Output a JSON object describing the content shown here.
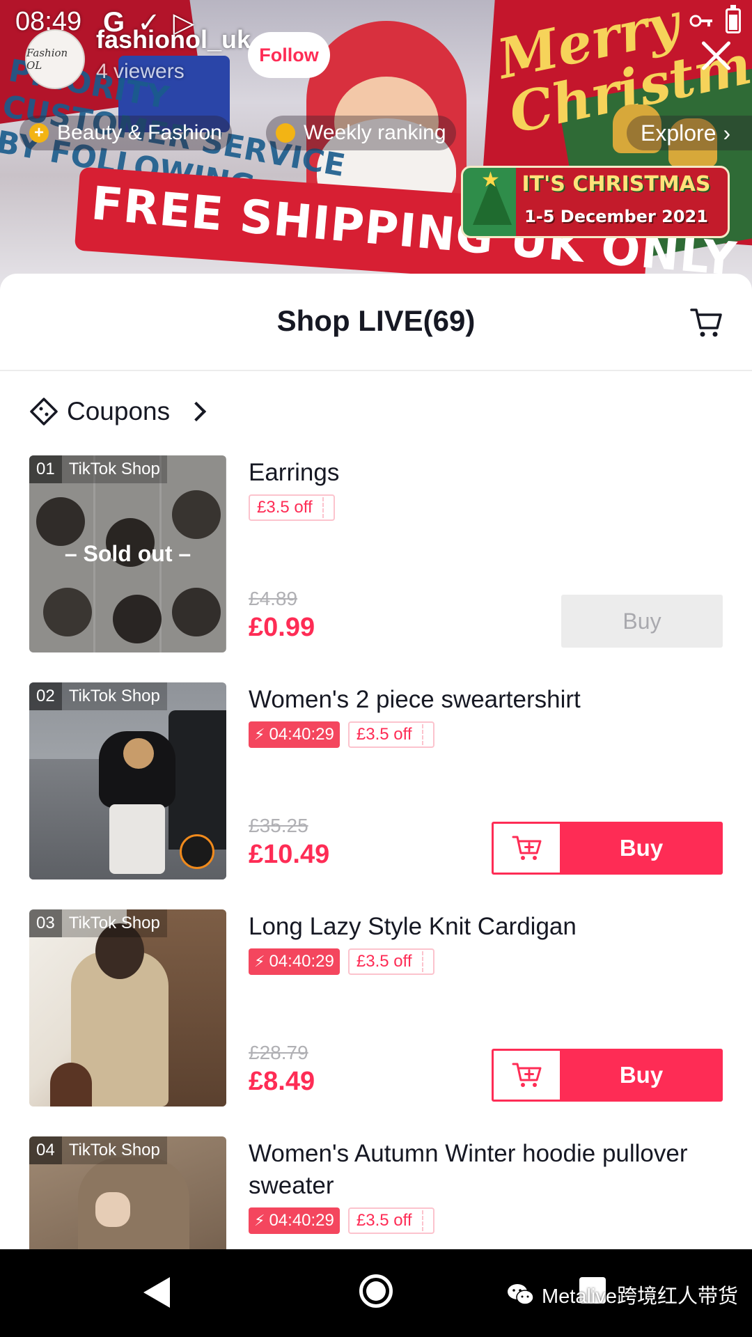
{
  "status_bar": {
    "time": "08:49",
    "left_icons": [
      "google-icon",
      "check-icon",
      "play-store-icon"
    ],
    "right_icons": [
      "vpn-key-icon",
      "battery-icon"
    ]
  },
  "live": {
    "host_name": "fashionol_uk",
    "avatar_text": "Fashion OL",
    "viewers": "4 viewers",
    "follow_label": "Follow",
    "tags": [
      {
        "label": "Beauty & Fashion"
      },
      {
        "label": "Weekly ranking"
      }
    ],
    "explore_label": "Explore",
    "background_text": {
      "ribbon": "FREE SHIPPING UK ONLY",
      "follow_promo": "PRIORITY CUSTOMER SERVICE BY FOLLOWING",
      "merry": "Merry Christmas"
    },
    "banner": {
      "line1": "IT'S CHRISTMAS",
      "line2": "1-5 December 2021"
    }
  },
  "shop": {
    "title": "Shop LIVE(69)",
    "coupons_label": "Coupons",
    "products": [
      {
        "index": "01",
        "shop": "TikTok Shop",
        "title": "Earrings",
        "flash_timer": null,
        "coupon": "£3.5 off",
        "old_price": "£4.89",
        "price": "£0.99",
        "buy_label": "Buy",
        "sold_out": "– Sold out –",
        "thumb_colors": [
          "#d9d7d3",
          "#a6a29e"
        ]
      },
      {
        "index": "02",
        "shop": "TikTok Shop",
        "title": "Women's 2 piece sweartershirt",
        "flash_timer": "04:40:29",
        "coupon": "£3.5 off",
        "old_price": "£35.25",
        "price": "£10.49",
        "buy_label": "Buy",
        "thumb_colors": [
          "#8e8f93",
          "#3b3b3f"
        ]
      },
      {
        "index": "03",
        "shop": "TikTok Shop",
        "title": "Long Lazy Style Knit Cardigan",
        "flash_timer": "04:40:29",
        "coupon": "£3.5 off",
        "old_price": "£28.79",
        "price": "£8.49",
        "buy_label": "Buy",
        "thumb_colors": [
          "#c8b79e",
          "#5a4436"
        ]
      },
      {
        "index": "04",
        "shop": "TikTok Shop",
        "title": "Women's Autumn Winter hoodie pullover sweater",
        "flash_timer": "04:40:29",
        "coupon": "£3.5 off",
        "thumb_colors": [
          "#8f7a66",
          "#5c4a3b"
        ]
      }
    ]
  },
  "watermark": "Metalive跨境红人带货",
  "colors": {
    "accent": "#fe2c55",
    "flash": "#f4465e",
    "text": "#161823",
    "muted": "#b0b0b4"
  }
}
